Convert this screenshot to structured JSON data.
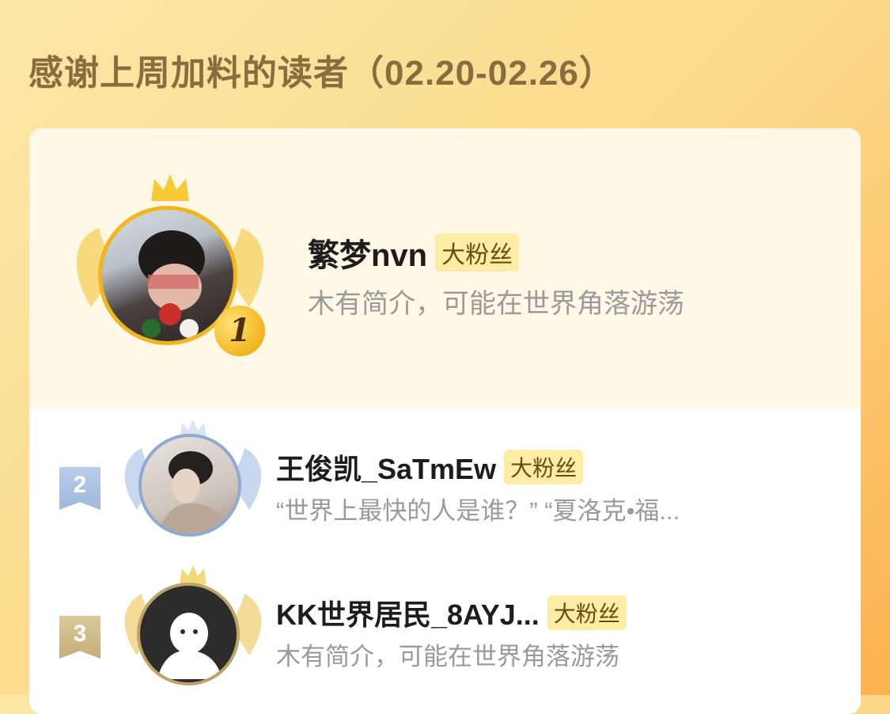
{
  "page": {
    "title": "感谢上周加料的读者（02.20-02.26）"
  },
  "readers": [
    {
      "rank": "1",
      "name": "繁梦nvn",
      "badge": "大粉丝",
      "intro": "木有简介，可能在世界角落游荡"
    },
    {
      "rank": "2",
      "name": "王俊凯_SaTmEw",
      "badge": "大粉丝",
      "intro": "“世界上最快的人是谁？” “夏洛克•福..."
    },
    {
      "rank": "3",
      "name": "KK世界居民_8AYJ...",
      "badge": "大粉丝",
      "intro": "木有简介，可能在世界角落游荡"
    }
  ],
  "colors": {
    "gold": "#f1b61c",
    "silver": "#9fb8dc",
    "bronze": "#c4ae78",
    "badge_bg": "#fdeca3"
  },
  "icons": [
    "crown-icon",
    "wing-icon",
    "default-avatar-icon"
  ]
}
